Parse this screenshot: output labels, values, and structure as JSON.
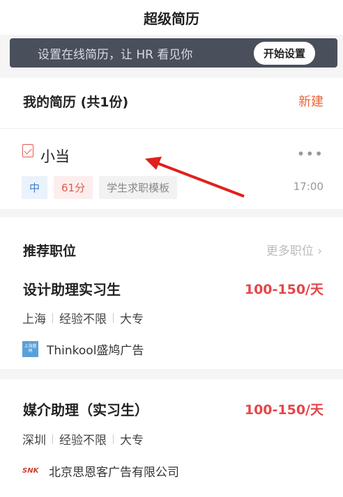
{
  "header": {
    "title": "超级简历"
  },
  "banner": {
    "text": "设置在线简历，让 HR 看见你",
    "button": "开始设置"
  },
  "resume": {
    "section_title": "我的简历 (共1份)",
    "new_label": "新建",
    "name": "小当",
    "more": "•••",
    "tags": {
      "level": "中",
      "score": "61分",
      "template": "学生求职模板"
    },
    "time": "17:00"
  },
  "recommend": {
    "title": "推荐职位",
    "more": "更多职位 ›",
    "jobs": [
      {
        "title": "设计助理实习生",
        "salary": "100-150/天",
        "city": "上海",
        "experience": "经验不限",
        "education": "大专",
        "company": "Thinkool盛鸠广告",
        "logo_text": "上海盛鸠"
      },
      {
        "title": "媒介助理（实习生）",
        "salary": "100-150/天",
        "city": "深圳",
        "experience": "经验不限",
        "education": "大专",
        "company": "北京思恩客广告有限公司",
        "logo_text": "SNK"
      }
    ]
  },
  "colors": {
    "accent": "#e8663d",
    "salary": "#e5464a",
    "banner_bg": "#4a4f5c",
    "arrow": "#e0201c"
  }
}
